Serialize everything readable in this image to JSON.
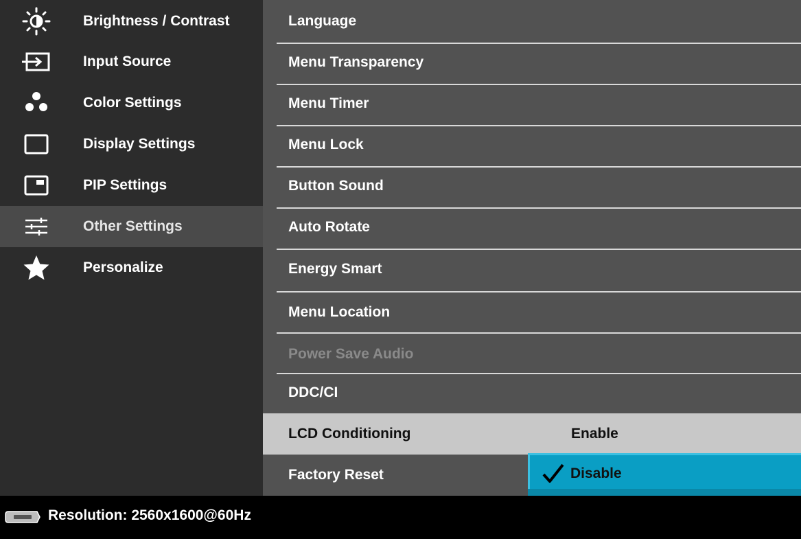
{
  "left_menu": {
    "items": [
      {
        "label": "Brightness / Contrast",
        "icon": "brightness-icon"
      },
      {
        "label": "Input Source",
        "icon": "input-source-icon"
      },
      {
        "label": "Color Settings",
        "icon": "color-settings-icon"
      },
      {
        "label": "Display Settings",
        "icon": "display-settings-icon"
      },
      {
        "label": "PIP Settings",
        "icon": "pip-icon"
      },
      {
        "label": "Other Settings",
        "icon": "sliders-icon",
        "selected": true
      },
      {
        "label": "Personalize",
        "icon": "star-icon"
      }
    ]
  },
  "submenu": {
    "items": [
      {
        "label": "Language"
      },
      {
        "label": "Menu Transparency"
      },
      {
        "label": "Menu Timer"
      },
      {
        "label": "Menu Lock"
      },
      {
        "label": "Button Sound"
      },
      {
        "label": "Auto Rotate"
      },
      {
        "label": "Energy Smart"
      },
      {
        "label": "Menu Location"
      },
      {
        "label": "Power Save Audio",
        "disabled": true
      },
      {
        "label": "DDC/CI"
      },
      {
        "label": "LCD Conditioning",
        "highlighted": true
      },
      {
        "label": "Factory Reset"
      }
    ],
    "options": {
      "enable_label": "Enable",
      "disable_label": "Disable",
      "selected": "Disable"
    }
  },
  "footer": {
    "resolution": "Resolution: 2560x1600@60Hz",
    "connector_icon": "displayport-icon"
  },
  "colors": {
    "left_bg": "#2c2c2c",
    "left_selected_bg": "#4a4a4a",
    "right_bg": "#525252",
    "highlight_bg": "#c8c8c8",
    "option_selected_bg": "#0a9ec4",
    "footer_bg": "#000000"
  }
}
